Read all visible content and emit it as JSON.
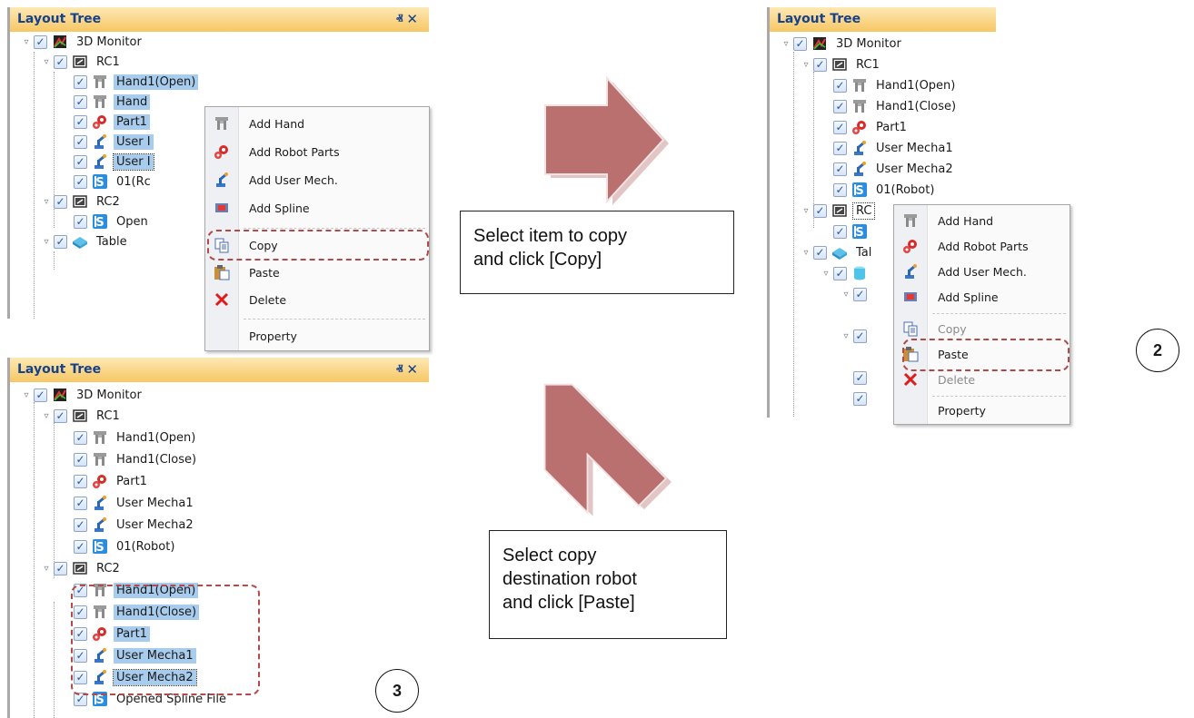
{
  "panel_title": "Layout Tree",
  "pin_glyph": "ⱏ",
  "close_glyph": "✕",
  "check_glyph": "✓",
  "expander_glyph": "▿",
  "panel1": {
    "rows": [
      "3D Monitor",
      "RC1",
      "Hand1(Open)",
      "Hand",
      "Part1",
      "User I",
      "User I",
      "01(Rc",
      "RC2",
      "Open",
      "Table"
    ]
  },
  "menu1": [
    "Add Hand",
    "Add Robot Parts",
    "Add User Mech.",
    "Add Spline",
    "Copy",
    "Paste",
    "Delete",
    "Property"
  ],
  "panel2": {
    "rows": [
      "3D Monitor",
      "RC1",
      "Hand1(Open)",
      "Hand1(Close)",
      "Part1",
      "User Mecha1",
      "User Mecha2",
      "01(Robot)",
      "RC",
      "Tal"
    ]
  },
  "menu2": [
    "Add Hand",
    "Add Robot Parts",
    "Add User Mech.",
    "Add Spline",
    "Copy",
    "Paste",
    "Delete",
    "Property"
  ],
  "panel3": {
    "rows": [
      "3D Monitor",
      "RC1",
      "Hand1(Open)",
      "Hand1(Close)",
      "Part1",
      "User Mecha1",
      "User Mecha2",
      "01(Robot)",
      "RC2",
      "Hand1(Open)",
      "Hand1(Close)",
      "Part1",
      "User Mecha1",
      "User Mecha2",
      "Opened Spline File"
    ]
  },
  "callout_copy": "Select item to copy\nand click [Copy]",
  "callout_paste": "Select copy\ndestination robot\nand click [Paste]",
  "step2": "2",
  "step3": "3",
  "colors": {
    "title_bar": "#f7c764",
    "title_text": "#15428b",
    "selection": "#a8ccee",
    "dashed_highlight": "#b34a4a",
    "arrow_fill": "#b9706f"
  }
}
